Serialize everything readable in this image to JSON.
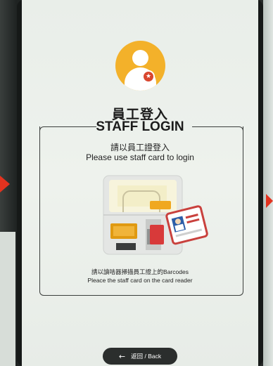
{
  "header": {
    "title_zh": "員工登入",
    "title_en": "STAFF LOGIN"
  },
  "avatar": {
    "icon": "staff-user-icon",
    "badge": "star-badge-icon",
    "accent": "#f3b12a"
  },
  "instructions": {
    "zh": "請以員工證登入",
    "en": "Please use staff card to login"
  },
  "illustration": {
    "icon": "card-reader-icon"
  },
  "footer": {
    "zh": "請以讀咭器掃描員工證上的Barcodes",
    "en": "Pleace the staff card on the card reader"
  },
  "back_button": {
    "label": "返回 / Back",
    "icon": "left-arrow-icon"
  },
  "colors": {
    "accent": "#f3b12a",
    "badge": "#d9462e",
    "card_red": "#d83a3a",
    "arrow": "#e3331f"
  }
}
